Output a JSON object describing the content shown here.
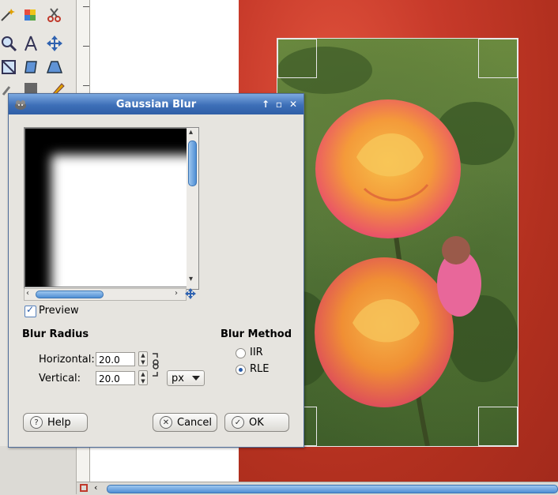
{
  "dialog": {
    "title": "Gaussian Blur",
    "preview_label": "Preview",
    "preview_checked": true,
    "blur_radius": {
      "heading": "Blur Radius",
      "horizontal_label": "Horizontal:",
      "horizontal_value": "20.0",
      "vertical_label": "Vertical:",
      "vertical_value": "20.0",
      "unit": "px"
    },
    "blur_method": {
      "heading": "Blur Method",
      "options": [
        "IIR",
        "RLE"
      ],
      "selected": "RLE"
    },
    "buttons": {
      "help": "Help",
      "cancel": "Cancel",
      "ok": "OK"
    }
  },
  "colors": {
    "titlebar": "#3d6fb8",
    "accent": "#4f8ed4",
    "canvas_background": "#c73a2a"
  },
  "icons": [
    "gimp-logo-icon",
    "shade-icon",
    "maximize-icon",
    "close-icon",
    "chain-link-icon",
    "navigate-icon",
    "help-icon",
    "cancel-icon",
    "ok-check-icon"
  ]
}
